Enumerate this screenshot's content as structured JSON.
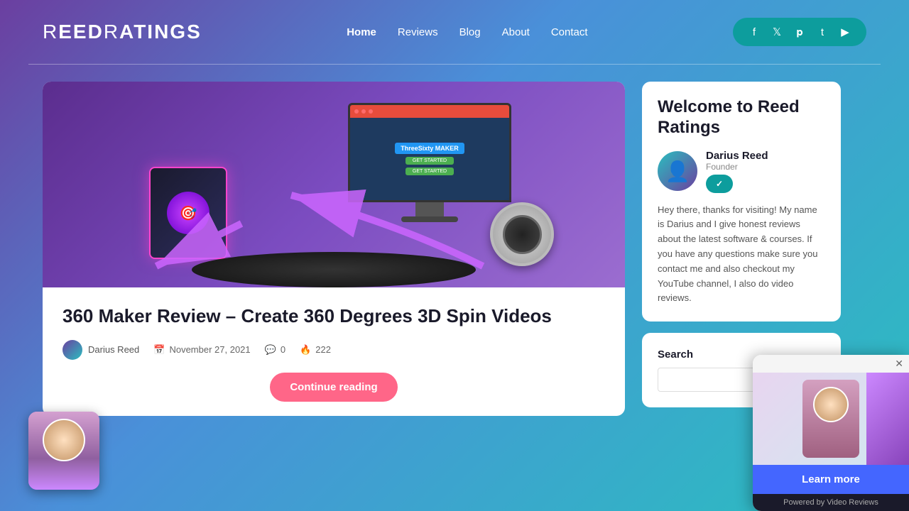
{
  "header": {
    "logo": "ReedRatings",
    "nav": {
      "home": "Home",
      "reviews": "Reviews",
      "blog": "Blog",
      "about": "About",
      "contact": "Contact"
    },
    "social": {
      "facebook": "f",
      "twitter": "t",
      "pinterest": "p",
      "tumblr": "T",
      "youtube": "▶"
    }
  },
  "article": {
    "title": "360 Maker Review – Create 360 Degrees 3D Spin Videos",
    "author": "Darius Reed",
    "date": "November 27, 2021",
    "comments": "0",
    "views": "222",
    "continue_btn": "Continue reading"
  },
  "sidebar": {
    "welcome_title": "Welcome to Reed Ratings",
    "author_name": "Darius",
    "author_full_name": "Darius Reed",
    "author_role": "Founder",
    "profile_btn": "☑",
    "welcome_text": "Hey there, thanks for visiting! My name is Darius and I give honest reviews about the latest software & courses. If you have any questions make sure you contact me and also checkout my YouTube channel, I also do video reviews.",
    "search": {
      "label": "Search",
      "placeholder": ""
    }
  },
  "video_popup": {
    "learn_more": "Learn more",
    "powered_by": "Powered by Video Reviews"
  }
}
